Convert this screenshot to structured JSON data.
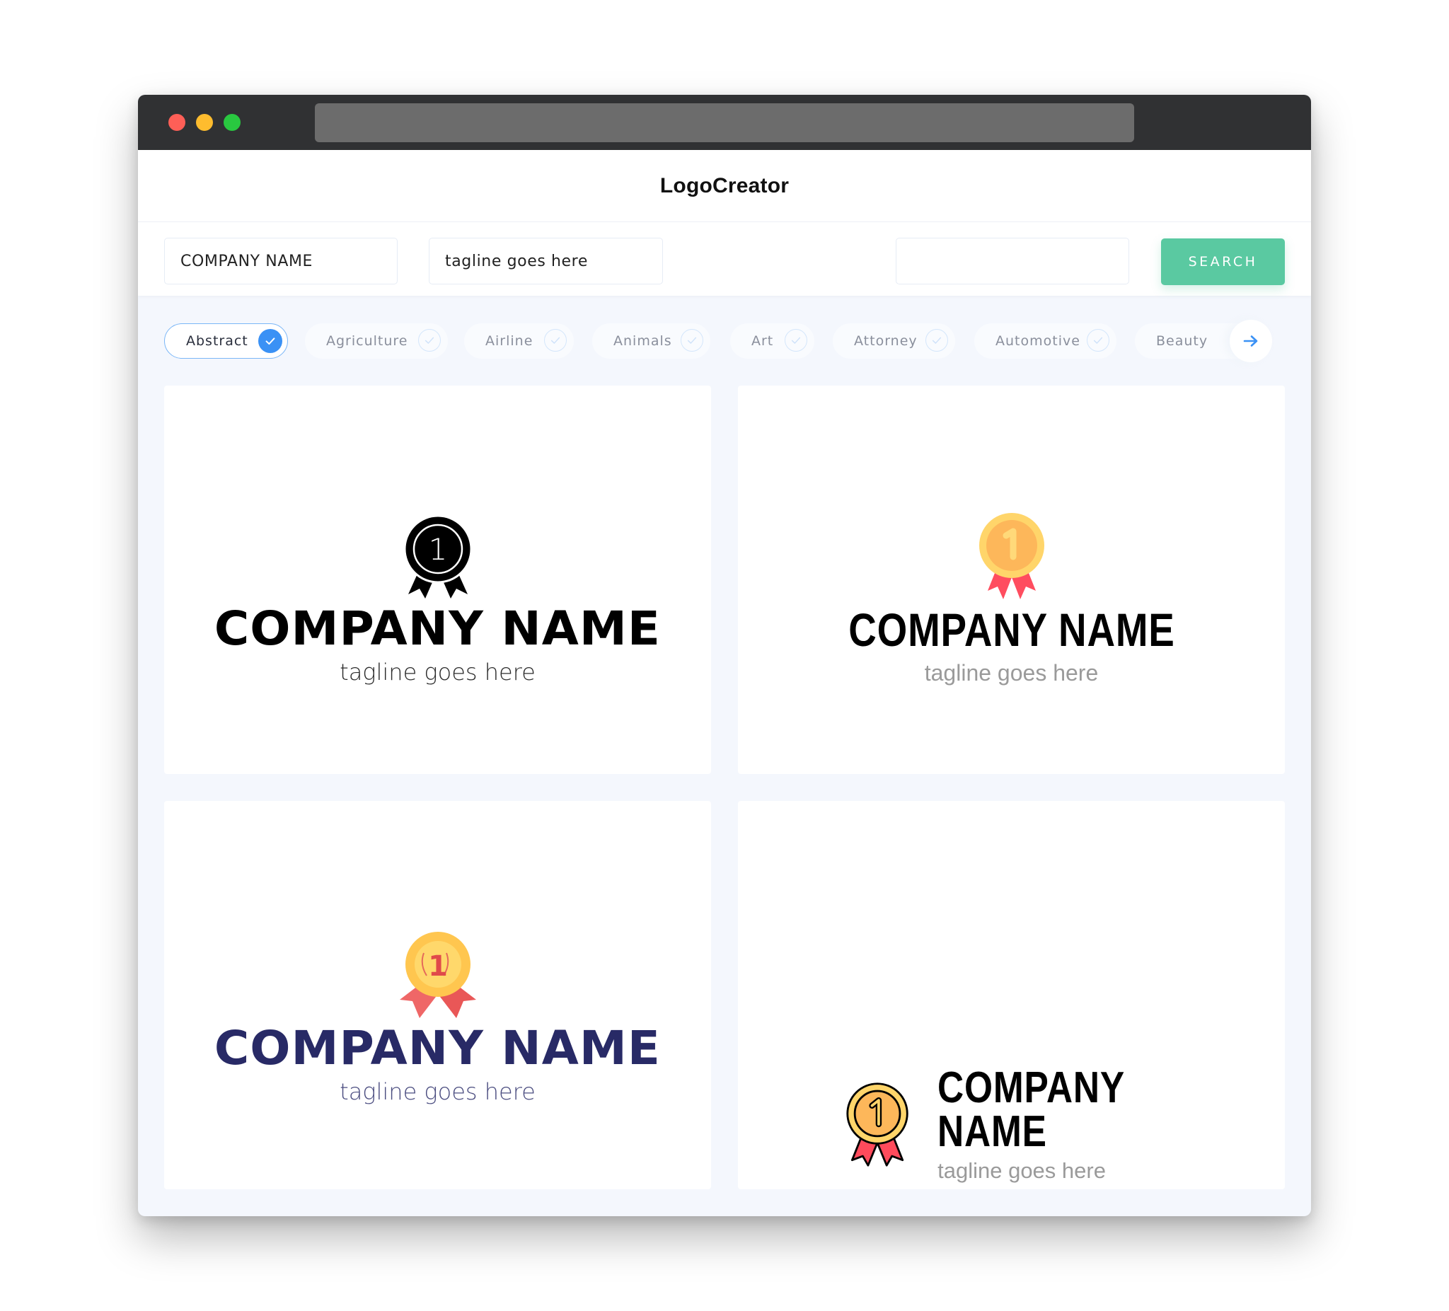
{
  "window": {
    "traffic_lights": [
      "close",
      "minimize",
      "maximize"
    ],
    "url": ""
  },
  "header": {
    "brand": "LogoCreator"
  },
  "toolbar": {
    "company_name_value": "COMPANY NAME",
    "tagline_value": "tagline goes here",
    "keyword_value": "",
    "search_label": "SEARCH",
    "search_color": "#5ac9a1"
  },
  "categories": {
    "items": [
      {
        "label": "Abstract",
        "selected": true
      },
      {
        "label": "Agriculture",
        "selected": false
      },
      {
        "label": "Airline",
        "selected": false
      },
      {
        "label": "Animals",
        "selected": false
      },
      {
        "label": "Art",
        "selected": false
      },
      {
        "label": "Attorney",
        "selected": false
      },
      {
        "label": "Automotive",
        "selected": false
      },
      {
        "label": "Beauty",
        "selected": false
      }
    ],
    "next_icon": "arrow-right-icon",
    "accent": "#3a91f5"
  },
  "logos": [
    {
      "icon": "black-ribbon-medal-icon",
      "icon_number": "1",
      "company": "COMPANY NAME",
      "tagline": "tagline goes here",
      "text_color": "#000000"
    },
    {
      "icon": "gold-medal-red-ribbon-icon",
      "icon_number": "1",
      "company": "COMPANY NAME",
      "tagline": "tagline goes here",
      "text_color": "#000000"
    },
    {
      "icon": "gold-laurel-medal-icon",
      "icon_number": "1",
      "company": "COMPANY NAME",
      "tagline": "tagline goes here",
      "text_color": "#282a66"
    },
    {
      "icon": "outlined-gold-medal-icon",
      "icon_number": "1",
      "company": "COMPANY NAME",
      "tagline": "tagline goes here",
      "text_color": "#000000"
    }
  ]
}
